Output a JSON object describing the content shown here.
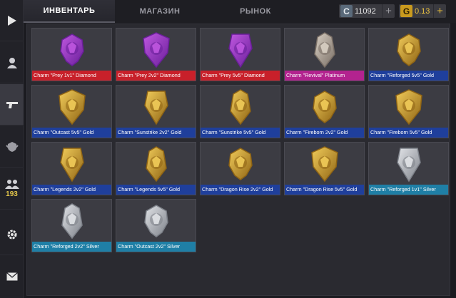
{
  "tabs": [
    {
      "label": "ИНВЕНТАРЬ",
      "active": true
    },
    {
      "label": "МАГАЗИН",
      "active": false
    },
    {
      "label": "РЫНОК",
      "active": false
    }
  ],
  "currency": {
    "credits": {
      "icon": "C",
      "value": "11092",
      "plus": "+"
    },
    "gold": {
      "icon": "G",
      "value": "0.13",
      "plus": "+"
    }
  },
  "sidebar": {
    "items": [
      {
        "name": "play-icon"
      },
      {
        "name": "profile-icon"
      },
      {
        "name": "weapon-icon"
      },
      {
        "name": "clan-icon"
      },
      {
        "name": "friends-icon",
        "count": "193"
      },
      {
        "name": "settings-icon"
      },
      {
        "name": "mail-icon"
      }
    ]
  },
  "colors": {
    "diamond": "#c8202a",
    "platinum": "#b3238f",
    "gold": "#1f3f9c",
    "silver": "#1f7fa6"
  },
  "inventory": [
    {
      "label": "Charm \"Prey 1v1\" Diamond",
      "tier": "diamond",
      "icon": "prey-1v1-diamond-charm-icon"
    },
    {
      "label": "Charm \"Prey 2v2\" Diamond",
      "tier": "diamond",
      "icon": "prey-2v2-diamond-charm-icon"
    },
    {
      "label": "Charm \"Prey 5v5\" Diamond",
      "tier": "diamond",
      "icon": "prey-5v5-diamond-charm-icon"
    },
    {
      "label": "Charm \"Revival\" Platinum",
      "tier": "platinum",
      "icon": "revival-platinum-charm-icon"
    },
    {
      "label": "Charm \"Reforged 5v5\" Gold",
      "tier": "gold",
      "icon": "reforged-5v5-gold-charm-icon"
    },
    {
      "label": "Charm \"Outcast 5v5\" Gold",
      "tier": "gold",
      "icon": "outcast-5v5-gold-charm-icon"
    },
    {
      "label": "Charm \"Sunstrike 2v2\" Gold",
      "tier": "gold",
      "icon": "sunstrike-2v2-gold-charm-icon"
    },
    {
      "label": "Charm \"Sunstrike 5v5\" Gold",
      "tier": "gold",
      "icon": "sunstrike-5v5-gold-charm-icon"
    },
    {
      "label": "Charm \"Fireborn 2v2\" Gold",
      "tier": "gold",
      "icon": "fireborn-2v2-gold-charm-icon"
    },
    {
      "label": "Charm \"Fireborn 5v5\" Gold",
      "tier": "gold",
      "icon": "fireborn-5v5-gold-charm-icon"
    },
    {
      "label": "Charm \"Legends 2v2\" Gold",
      "tier": "gold",
      "icon": "legends-2v2-gold-charm-icon"
    },
    {
      "label": "Charm \"Legends 5v5\" Gold",
      "tier": "gold",
      "icon": "legends-5v5-gold-charm-icon"
    },
    {
      "label": "Charm \"Dragon Rise 2v2\" Gold",
      "tier": "gold",
      "icon": "dragon-rise-2v2-gold-charm-icon"
    },
    {
      "label": "Charm \"Dragon Rise 5v5\" Gold",
      "tier": "gold",
      "icon": "dragon-rise-5v5-gold-charm-icon"
    },
    {
      "label": "Charm \"Reforged 1v1\" Silver",
      "tier": "silver",
      "icon": "reforged-1v1-silver-charm-icon"
    },
    {
      "label": "Charm \"Reforged 2v2\" Silver",
      "tier": "silver",
      "icon": "reforged-2v2-silver-charm-icon"
    },
    {
      "label": "Charm \"Outcast 2v2\" Silver",
      "tier": "silver",
      "icon": "outcast-2v2-silver-charm-icon"
    }
  ]
}
